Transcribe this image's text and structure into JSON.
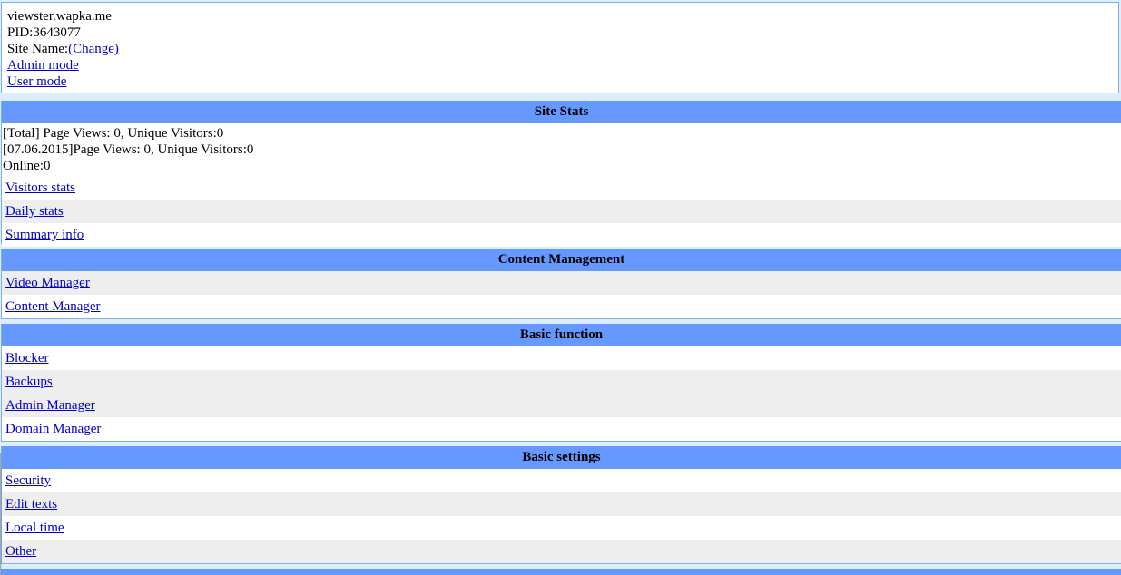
{
  "site_info": {
    "domain": "viewster.wapka.me",
    "pid": "PID:3643077",
    "site_name_label": "Site Name:",
    "site_name_change": "(Change)",
    "admin_mode": "Admin mode",
    "user_mode": "User mode"
  },
  "site_stats": {
    "header": "Site Stats",
    "total_line": "[Total] Page Views: 0, Unique Visitors:0",
    "daily_line": "[07.06.2015]Page Views: 0, Unique Visitors:0",
    "online_line": "Online:0",
    "links": [
      "Visitors stats",
      "Daily stats",
      "Summary info"
    ]
  },
  "content_management": {
    "header": "Content Management",
    "links": [
      "Video Manager",
      "Content Manager"
    ]
  },
  "basic_function": {
    "header": "Basic function",
    "links": [
      "Blocker",
      "Backups",
      "Admin Manager",
      "Domain Manager"
    ]
  },
  "basic_settings": {
    "header": "Basic settings",
    "links": [
      "Security",
      "Edit texts",
      "Local time",
      "Other"
    ]
  },
  "colors": {
    "header_bg": "#6699ff",
    "alt_row_bg": "#eeeeee",
    "link": "#0000cc",
    "border": "#7bb0e8"
  }
}
